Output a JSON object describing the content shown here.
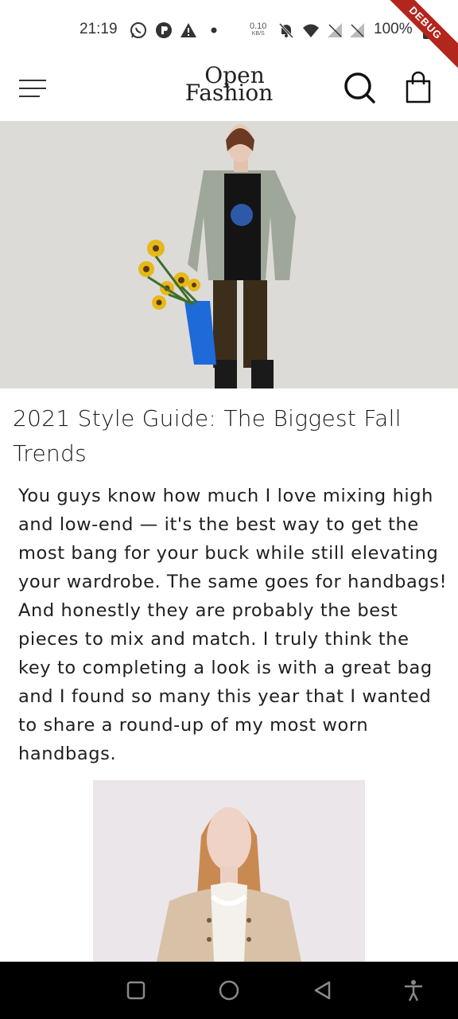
{
  "status_bar": {
    "time": "21:19",
    "net_speed_value": "0.10",
    "net_speed_unit": "KB/S",
    "battery": "100%",
    "icons": [
      "whatsapp-icon",
      "app-p-icon",
      "warning-icon",
      "dot-icon",
      "bell-off-icon",
      "wifi-icon",
      "signal-icon",
      "signal-2-icon",
      "battery-icon"
    ]
  },
  "debug_banner": "DEBUG",
  "header": {
    "logo_line1": "Open",
    "logo_line2": "Fashion",
    "icons": [
      "menu-icon",
      "search-icon",
      "shopping-bag-icon"
    ]
  },
  "article": {
    "title": "2021 Style Guide: The Biggest Fall Trends",
    "body": "You guys know how much I love mixing high and low-end — it's the best way to get the most bang for your buck while still elevating your wardrobe. The same goes for handbags! And honestly they are probably the best pieces to mix and match. I truly think the key to completing a look is with a great bag and I found so many this year that I wanted to share a round-up of my most worn handbags."
  },
  "nav_bar": {
    "icons": [
      "recents-icon",
      "home-icon",
      "back-icon",
      "accessibility-icon"
    ]
  },
  "colors": {
    "background": "#ffffff",
    "text": "#1a1a1a",
    "debug_ribbon": "#b3261e",
    "nav_bar": "#000000"
  }
}
